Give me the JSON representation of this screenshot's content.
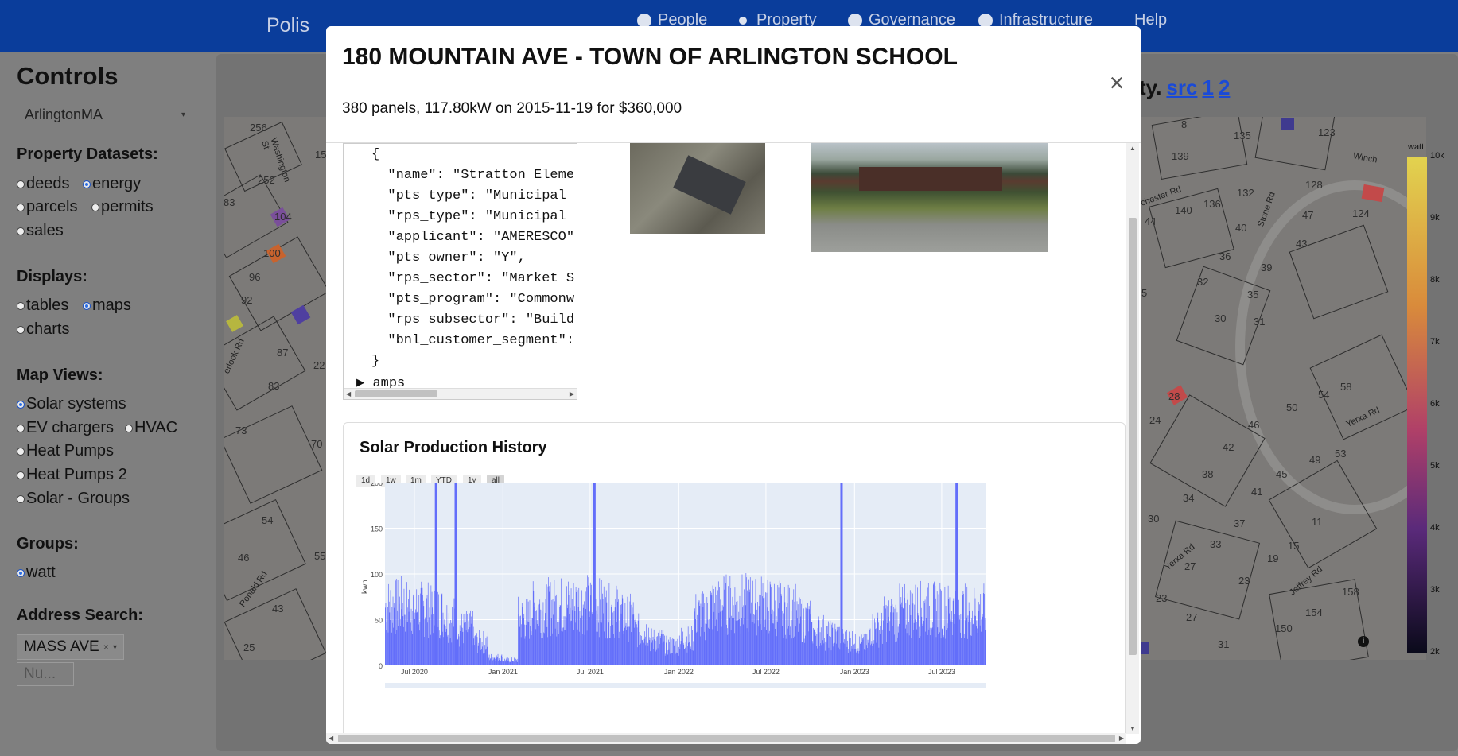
{
  "navbar": {
    "brand": "Polis",
    "items": [
      "People",
      "Property",
      "Governance",
      "Infrastructure",
      "Help"
    ]
  },
  "sidebar": {
    "title": "Controls",
    "dataset_select": "ArlingtonMA",
    "property_datasets": {
      "label": "Property Datasets:",
      "options": [
        "deeds",
        "energy",
        "parcels",
        "permits",
        "sales"
      ],
      "selected": "energy"
    },
    "displays": {
      "label": "Displays:",
      "options": [
        "tables",
        "maps",
        "charts"
      ],
      "selected": "maps"
    },
    "map_views": {
      "label": "Map Views:",
      "options": [
        "Solar systems",
        "EV chargers",
        "HVAC",
        "Heat Pumps",
        "Heat Pumps 2",
        "Solar - Groups"
      ],
      "selected": "Solar systems"
    },
    "groups": {
      "label": "Groups:",
      "options": [
        "watt"
      ],
      "selected": "watt"
    },
    "address_search": {
      "label": "Address Search:",
      "street_value": "MASS AVE",
      "number_placeholder": "Nu..."
    }
  },
  "background": {
    "text_tail": "ty.",
    "links": [
      "src",
      "1",
      "2"
    ],
    "colorbar": {
      "title": "watt",
      "ticks": [
        "10k",
        "9k",
        "8k",
        "7k",
        "6k",
        "5k",
        "4k",
        "3k",
        "2k"
      ]
    },
    "map_left_labels": [
      "256",
      "252",
      "83",
      "104",
      "100",
      "96",
      "92",
      "87",
      "83",
      "73",
      "70",
      "54",
      "46",
      "43",
      "25",
      "22",
      "55",
      "15"
    ],
    "map_left_streets": [
      "Washington St",
      "erlook Rd",
      "Ronald Rd"
    ],
    "map_right_labels": [
      "8",
      "135",
      "123",
      "139",
      "136",
      "132",
      "128",
      "44",
      "140",
      "40",
      "47",
      "124",
      "36",
      "43",
      "5",
      "32",
      "39",
      "35",
      "30",
      "31",
      "28",
      "24",
      "50",
      "54",
      "58",
      "46",
      "42",
      "49",
      "53",
      "38",
      "45",
      "41",
      "34",
      "30",
      "37",
      "11",
      "33",
      "15",
      "27",
      "19",
      "23",
      "158",
      "23",
      "27",
      "154",
      "150",
      "31"
    ],
    "map_right_streets": [
      "Winch",
      "chester Rd",
      "Stone Rd",
      "Yerxa Rd",
      "Yerxa Rd",
      "Jeffrey Rd"
    ]
  },
  "modal": {
    "title": "180 MOUNTAIN AVE - TOWN OF ARLINGTON SCHOOL",
    "subtitle": "380 panels, 117.80kW on 2015-11-19 for $360,000",
    "close_symbol": "×",
    "json_lines": [
      "{",
      "  \"name\": \"Stratton Eleme",
      "  \"pts_type\": \"Municipal ",
      "  \"rps_type\": \"Municipal ",
      "  \"applicant\": \"AMERESCO\"",
      "  \"pts_owner\": \"Y\",",
      "  \"rps_sector\": \"Market S",
      "  \"pts_program\": \"Commonw",
      "  \"rps_subsector\": \"Build",
      "  \"bnl_customer_segment\":",
      "}"
    ],
    "amps_label": "amps",
    "chart_card": {
      "title": "Solar Production History",
      "range_buttons": [
        "1d",
        "1w",
        "1m",
        "YTD",
        "1y",
        "all"
      ],
      "active_range": "all"
    }
  },
  "chart_data": {
    "type": "bar",
    "title": "Solar Production History",
    "xlabel": "",
    "ylabel": "kwh",
    "ylim": [
      0,
      200
    ],
    "y_ticks": [
      0,
      50,
      100,
      150,
      200
    ],
    "x_ticks": [
      "Jul 2020",
      "Jan 2021",
      "Jul 2021",
      "Jan 2022",
      "Jul 2022",
      "Jan 2023",
      "Jul 2023"
    ],
    "x_range": [
      "2020-05-01",
      "2023-09-30"
    ],
    "color": "#636efa",
    "monthly_typical": [
      {
        "month": "2020-05",
        "value": 88
      },
      {
        "month": "2020-06",
        "value": 90
      },
      {
        "month": "2020-07",
        "value": 85
      },
      {
        "month": "2020-08",
        "value": 80
      },
      {
        "month": "2020-09",
        "value": 70
      },
      {
        "month": "2020-10",
        "value": 55
      },
      {
        "month": "2020-11",
        "value": 35
      },
      {
        "month": "2020-12",
        "value": 12
      },
      {
        "month": "2021-01",
        "value": 8
      },
      {
        "month": "2021-02",
        "value": 70
      },
      {
        "month": "2021-03",
        "value": 85
      },
      {
        "month": "2021-04",
        "value": 88
      },
      {
        "month": "2021-05",
        "value": 90
      },
      {
        "month": "2021-06",
        "value": 92
      },
      {
        "month": "2021-07",
        "value": 88
      },
      {
        "month": "2021-08",
        "value": 82
      },
      {
        "month": "2021-09",
        "value": 72
      },
      {
        "month": "2021-10",
        "value": 52
      },
      {
        "month": "2021-11",
        "value": 38
      },
      {
        "month": "2021-12",
        "value": 30
      },
      {
        "month": "2022-01",
        "value": 40
      },
      {
        "month": "2022-02",
        "value": 75
      },
      {
        "month": "2022-03",
        "value": 88
      },
      {
        "month": "2022-04",
        "value": 92
      },
      {
        "month": "2022-05",
        "value": 93
      },
      {
        "month": "2022-06",
        "value": 92
      },
      {
        "month": "2022-07",
        "value": 88
      },
      {
        "month": "2022-08",
        "value": 82
      },
      {
        "month": "2022-09",
        "value": 68
      },
      {
        "month": "2022-10",
        "value": 52
      },
      {
        "month": "2022-11",
        "value": 45
      },
      {
        "month": "2022-12",
        "value": 38
      },
      {
        "month": "2023-01",
        "value": 32
      },
      {
        "month": "2023-02",
        "value": 55
      },
      {
        "month": "2023-03",
        "value": 70
      },
      {
        "month": "2023-04",
        "value": 82
      },
      {
        "month": "2023-05",
        "value": 85
      },
      {
        "month": "2023-06",
        "value": 84
      },
      {
        "month": "2023-07",
        "value": 83
      },
      {
        "month": "2023-08",
        "value": 82
      },
      {
        "month": "2023-09",
        "value": 82
      }
    ],
    "spikes": [
      {
        "date": "2020-08-15",
        "value": 200
      },
      {
        "date": "2020-09-25",
        "value": 200
      },
      {
        "date": "2021-07-10",
        "value": 200
      },
      {
        "date": "2022-12-05",
        "value": 200
      },
      {
        "date": "2023-08-01",
        "value": 200
      }
    ]
  }
}
